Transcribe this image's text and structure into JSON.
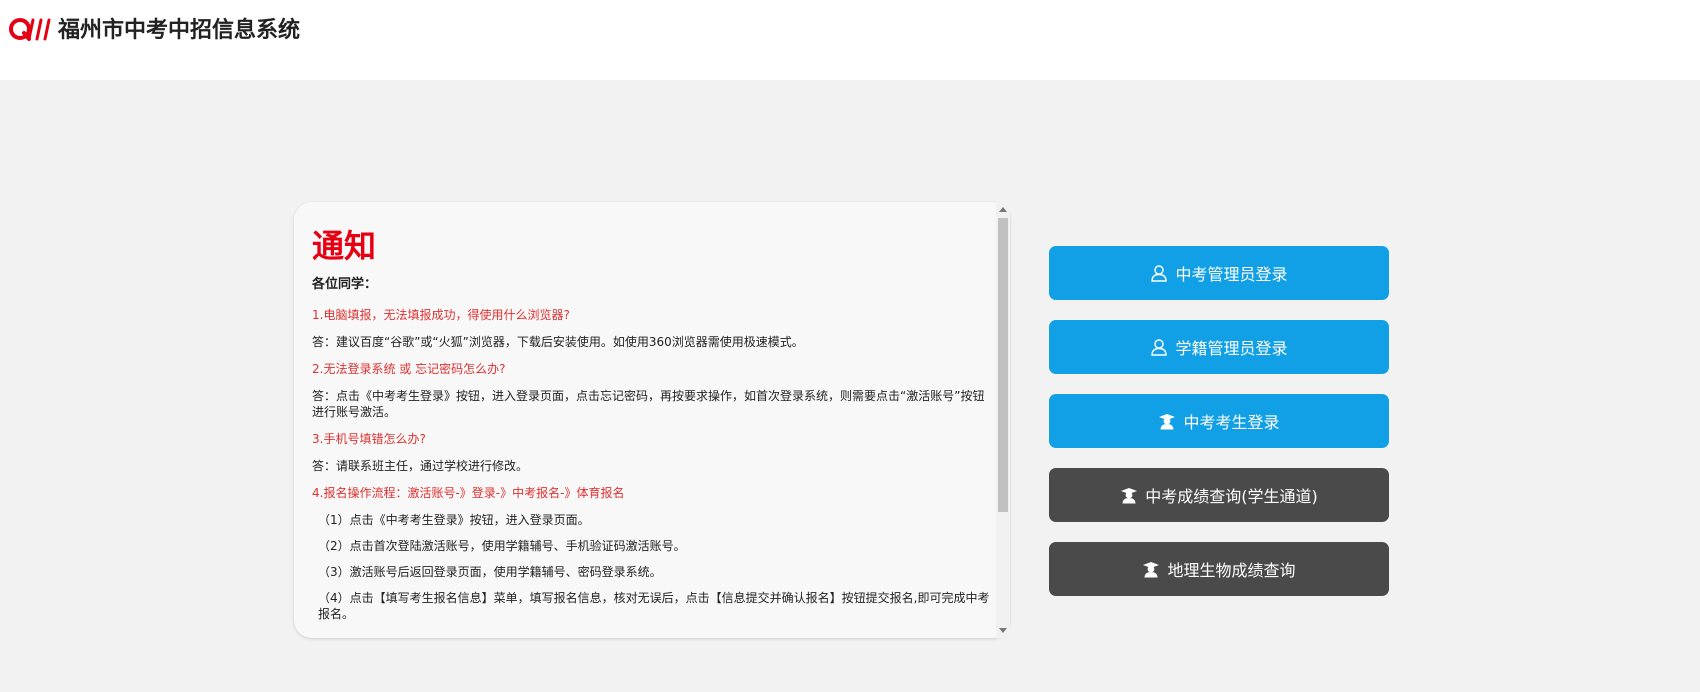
{
  "header": {
    "app_title": "福州市中考中招信息系统",
    "logo_icon": "qw-logo-icon",
    "brand_color": "#e60012"
  },
  "notice": {
    "title": "通知",
    "greeting": "各位同学：",
    "q1": "1.电脑填报，无法填报成功，得使用什么浏览器?",
    "a1": "答：建议百度“谷歌”或“火狐”浏览器，下载后安装使用。如使用360浏览器需使用极速模式。",
    "q2": "2.无法登录系统 或 忘记密码怎么办?",
    "a2": "答：点击《中考考生登录》按钮，进入登录页面，点击忘记密码，再按要求操作，如首次登录系统，则需要点击“激活账号”按钮进行账号激活。",
    "q3": "3.手机号填错怎么办?",
    "a3": "答：请联系班主任，通过学校进行修改。",
    "q4": "4.报名操作流程：激活账号-》登录-》中考报名-》体育报名",
    "steps": [
      "（1）点击《中考考生登录》按钮，进入登录页面。",
      "（2）点击首次登陆激活账号，使用学籍辅号、手机验证码激活账号。",
      "（3）激活账号后返回登录页面，使用学籍辅号、密码登录系统。",
      "（4）点击【填写考生报名信息】菜单，填写报名信息，核对无误后，点击【信息提交并确认报名】按钮提交报名,即可完成中考报名。"
    ]
  },
  "buttons": {
    "admin_login": "中考管理员登录",
    "registry_admin_login": "学籍管理员登录",
    "student_login": "中考考生登录",
    "score_query": "中考成绩查询(学生通道)",
    "geo_bio_query": "地理生物成绩查询",
    "admin_icon": "user-outline-icon",
    "student_icon": "graduate-student-icon",
    "blue_color": "#11a0e5",
    "dark_color": "#4a4a4a"
  }
}
